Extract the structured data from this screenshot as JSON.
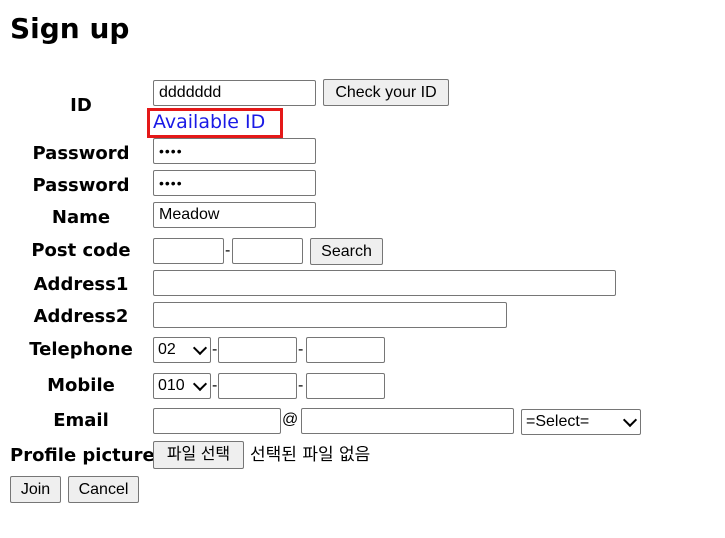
{
  "page": {
    "title": "Sign up"
  },
  "form": {
    "id": {
      "label": "ID",
      "value": "ddddddd",
      "check_button": "Check your ID",
      "status": "Available ID",
      "status_color": "#1a1ae6",
      "highlight_color": "#e41818"
    },
    "password": {
      "label": "Password",
      "value": "••••"
    },
    "password_confirm": {
      "label": "Password",
      "value": "••••"
    },
    "name": {
      "label": "Name",
      "value": "Meadow"
    },
    "post_code": {
      "label": "Post code",
      "part1": "",
      "separator": "-",
      "part2": "",
      "search_button": "Search"
    },
    "address1": {
      "label": "Address1",
      "value": ""
    },
    "address2": {
      "label": "Address2",
      "value": ""
    },
    "telephone": {
      "label": "Telephone",
      "area_code": "02",
      "separator": "-",
      "part2": "",
      "part3": ""
    },
    "mobile": {
      "label": "Mobile",
      "prefix": "010",
      "separator": "-",
      "part2": "",
      "part3": ""
    },
    "email": {
      "label": "Email",
      "local": "",
      "at": "@",
      "domain": "",
      "domain_select": "=Select="
    },
    "profile_picture": {
      "label": "Profile picture",
      "choose_button": "파일 선택",
      "file_status": "선택된 파일 없음"
    }
  },
  "actions": {
    "join": "Join",
    "cancel": "Cancel"
  }
}
